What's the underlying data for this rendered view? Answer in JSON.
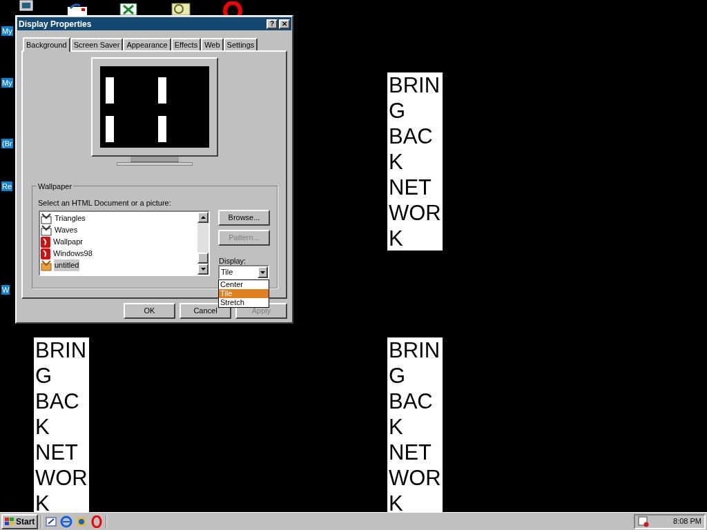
{
  "desktop": {
    "icon_labels": [
      "My",
      "My",
      "(Br",
      "Re",
      "W"
    ],
    "wallpaper_tiles": [
      {
        "lines": [
          "BRIN",
          "G",
          "BAC",
          "K",
          "NET",
          "WOR",
          "K"
        ]
      },
      {
        "lines": [
          "BRIN",
          "G",
          "BAC",
          "K",
          "NET",
          "WOR",
          "K"
        ]
      },
      {
        "lines": [
          "BRIN",
          "G",
          "BAC",
          "K",
          "NET",
          "WOR",
          "K"
        ]
      }
    ]
  },
  "window": {
    "title": "Display Properties",
    "title_buttons": [
      "?",
      "✕"
    ]
  },
  "tabs": [
    {
      "label": "Background",
      "selected": true
    },
    {
      "label": "Screen Saver",
      "selected": false
    },
    {
      "label": "Appearance",
      "selected": false
    },
    {
      "label": "Effects",
      "selected": false
    },
    {
      "label": "Web",
      "selected": false
    },
    {
      "label": "Settings",
      "selected": false
    }
  ],
  "wallpaper": {
    "group_label": "Wallpaper",
    "list_label": "Select an HTML Document or a picture:",
    "items": [
      {
        "label": "Triangles",
        "kind": "html",
        "selected": false
      },
      {
        "label": "Waves",
        "kind": "html",
        "selected": false
      },
      {
        "label": "Wallpapr",
        "kind": "picture",
        "selected": false
      },
      {
        "label": "Windows98",
        "kind": "picture",
        "selected": false
      },
      {
        "label": "untitled",
        "kind": "file",
        "selected": true
      }
    ],
    "buttons": [
      {
        "label": "Browse...",
        "disabled": false
      },
      {
        "label": "Pattern...",
        "disabled": true
      }
    ],
    "display_label": "Display:",
    "display_value": "Tile",
    "display_options": [
      {
        "label": "Center",
        "selected": false
      },
      {
        "label": "Tile",
        "selected": true
      },
      {
        "label": "Stretch",
        "selected": false
      }
    ]
  },
  "dialog_buttons": [
    {
      "label": "OK",
      "disabled": false
    },
    {
      "label": "Cancel",
      "disabled": false
    },
    {
      "label": "Apply",
      "disabled": true
    }
  ],
  "taskbar": {
    "start": "Start",
    "clock": "8:08 PM"
  }
}
